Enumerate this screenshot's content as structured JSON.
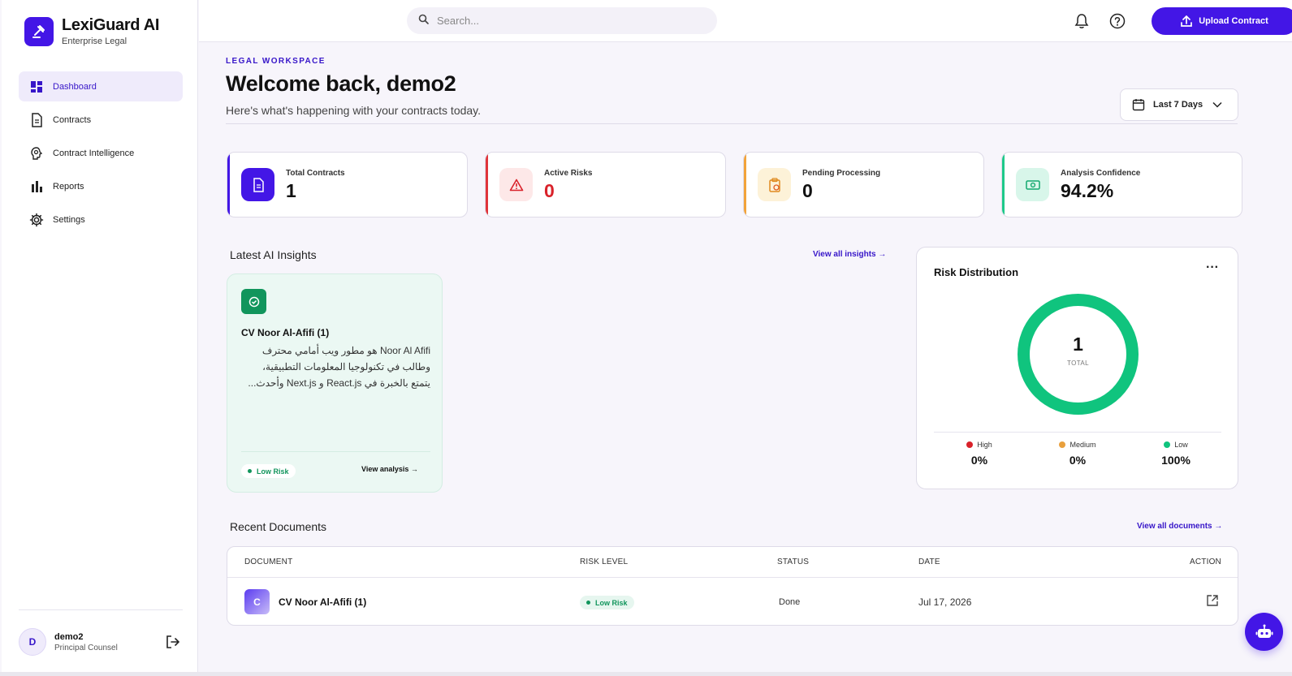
{
  "brand": {
    "name": "LexiGuard AI",
    "subtitle": "Enterprise Legal"
  },
  "sidebar": {
    "items": [
      {
        "label": "Dashboard",
        "icon": "dashboard-icon",
        "active": true
      },
      {
        "label": "Contracts",
        "icon": "document-icon"
      },
      {
        "label": "Contract Intelligence",
        "icon": "brain-icon"
      },
      {
        "label": "Reports",
        "icon": "bar-chart-icon"
      },
      {
        "label": "Settings",
        "icon": "gear-icon"
      }
    ]
  },
  "user": {
    "initial": "D",
    "name": "demo2",
    "role": "Principal Counsel"
  },
  "topbar": {
    "search_placeholder": "Search...",
    "upload_label": "Upload Contract"
  },
  "header": {
    "eyebrow": "LEGAL WORKSPACE",
    "title": "Welcome back, demo2",
    "subtitle": "Here's what's happening with your contracts today.",
    "range_label": "Last 7 Days"
  },
  "stats": [
    {
      "label": "Total Contracts",
      "value": "1",
      "accent": "#4316e6"
    },
    {
      "label": "Active Risks",
      "value": "0",
      "accent": "#e0343a"
    },
    {
      "label": "Pending Processing",
      "value": "0",
      "accent": "#f2a33a"
    },
    {
      "label": "Analysis Confidence",
      "value": "94.2%",
      "accent": "#1ec98a"
    }
  ],
  "insights": {
    "title": "Latest AI Insights",
    "view_all": "View all insights",
    "cards": [
      {
        "title": "CV Noor Al-Afifi (1)",
        "body": "Noor Al Afifi هو مطور ويب أمامي محترف وطالب في تكنولوجيا المعلومات التطبيقية، يتمتع بالخبرة في React.js و Next.js وأحدث...",
        "risk": "Low Risk",
        "action": "View analysis"
      }
    ]
  },
  "risk_distribution": {
    "title": "Risk Distribution",
    "total": "1",
    "total_caption": "TOTAL",
    "legend": [
      {
        "label": "High",
        "pct": "0%",
        "color": "#d9222a"
      },
      {
        "label": "Medium",
        "pct": "0%",
        "color": "#e9a03d"
      },
      {
        "label": "Low",
        "pct": "100%",
        "color": "#10c47e"
      }
    ]
  },
  "documents": {
    "title": "Recent Documents",
    "view_all": "View all documents",
    "columns": [
      "DOCUMENT",
      "RISK LEVEL",
      "STATUS",
      "DATE",
      "ACTION"
    ],
    "rows": [
      {
        "initial": "C",
        "name": "CV Noor Al-Afifi (1)",
        "risk": "Low Risk",
        "status": "Done",
        "date": "Jul 17, 2026"
      }
    ]
  }
}
